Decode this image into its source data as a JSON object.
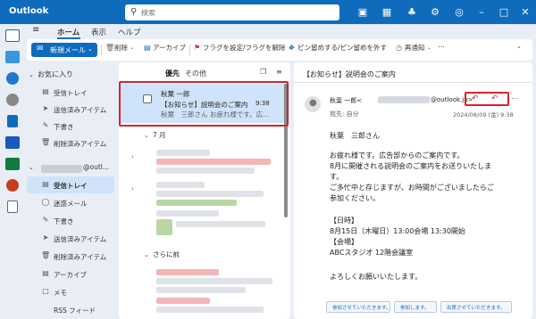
{
  "titlebar": {
    "app_title": "Outlook",
    "search_placeholder": "検索",
    "icons": [
      "teams-icon",
      "calendar-icon",
      "bell-icon",
      "settings-icon",
      "lightbulb-icon",
      "minimize-icon",
      "maximize-icon",
      "close-icon"
    ]
  },
  "ribbon": {
    "tabs": [
      "ホーム",
      "表示",
      "ヘルプ"
    ],
    "new_mail": "新規メール",
    "delete": "削除",
    "archive": "アーカイブ",
    "flag": "フラグを設定/フラグを解除",
    "pin": "ピン留めする/ピン留めを外す",
    "snooze": "再通知"
  },
  "folders": {
    "favorites_header": "お気に入り",
    "favorites": [
      "受信トレイ",
      "送信済みアイテム",
      "下書き",
      "削除済みアイテム"
    ],
    "account_suffix": "@outl...",
    "account_items": [
      "受信トレイ",
      "迷惑メール",
      "下書き",
      "送信済みアイテム",
      "削除済みアイテム",
      "アーカイブ",
      "メモ",
      "RSS フィード"
    ]
  },
  "list": {
    "tab_focused": "優先",
    "tab_other": "その他",
    "selected": {
      "sender": "秋葉 一郎",
      "subject": "【お知らせ】説明会のご案内",
      "time": "9:38",
      "preview": "秋葉　三郎さん お疲れ様です。広..."
    },
    "group_july": "7 月",
    "group_older": "さらに前"
  },
  "reader": {
    "title": "【お知らせ】説明会のご案内",
    "from_name": "秋葉 一郎<",
    "from_domain": "@outlook.jp>",
    "to": "宛先: 自分",
    "date": "2024/08/09 (金) 9:38",
    "body": [
      "秋葉　三郎さん",
      "お疲れ様です。広告部からのご案内です。",
      "8月に開催される説明会のご案内をお送りいたしま",
      "す。",
      "ご多忙中と存じますが、お時間がございましたらご",
      "参加ください。",
      "【日時】",
      "8月15日（木曜日）13:00会場 13:30開始",
      "【会場】",
      "ABCスタジオ 12階会議室",
      "よろしくお願いいたします。"
    ],
    "suggestions": [
      "参加させていただきます。",
      "参加します。",
      "出席させていただきます。"
    ]
  },
  "colors": {
    "brand": "#0f6cbd",
    "selection": "#cfe4fa",
    "highlight": "#d8232a"
  }
}
